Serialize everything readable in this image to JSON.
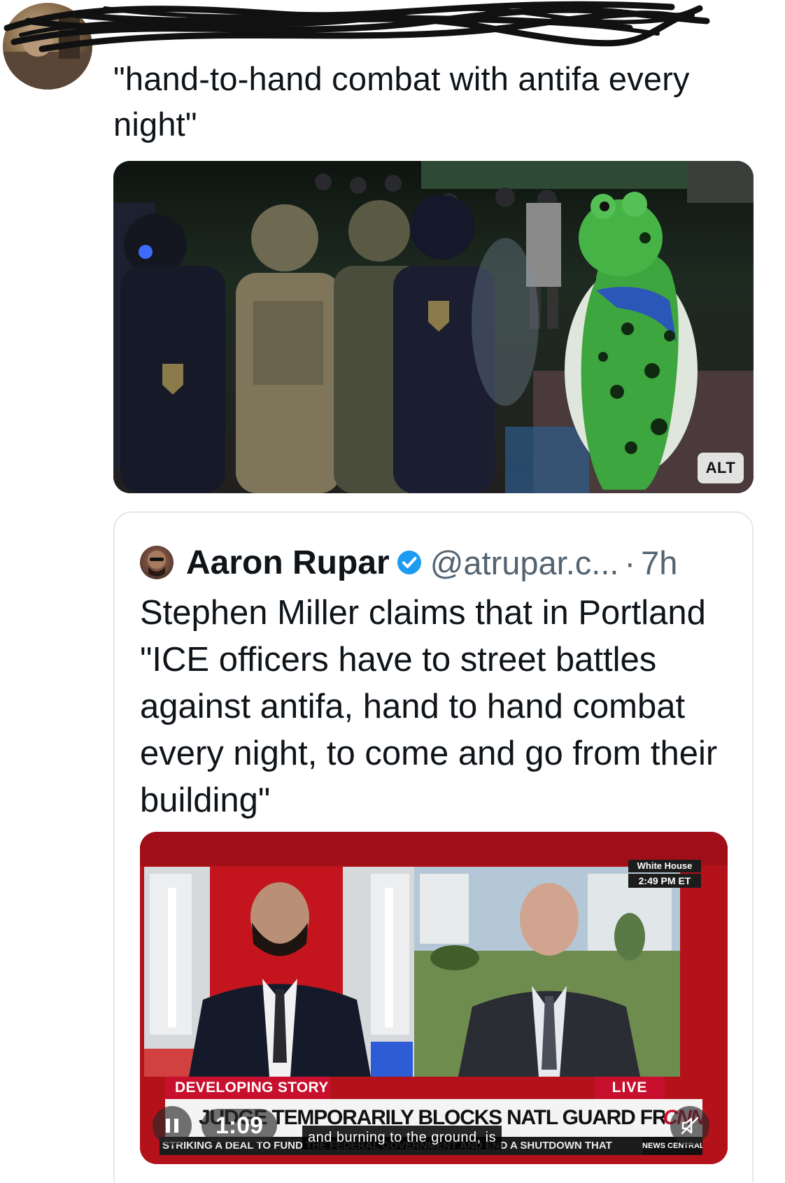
{
  "post": {
    "text": "\"hand-to-hand combat with antifa every night\""
  },
  "photo": {
    "alt_badge": "ALT"
  },
  "quoted_post": {
    "author_name": "Aaron Rupar",
    "handle": "@atrupar.c...",
    "separator": "·",
    "time": "7h",
    "text": "Stephen Miller claims that in Portland \"ICE officers have to street battles against antifa, hand to hand combat every night, to come and go from their building\""
  },
  "video": {
    "location_label": "White House",
    "location_time": "2:49 PM ET",
    "segment_label": "DEVELOPING STORY",
    "live_label": "LIVE",
    "headline": "JUDGE TEMPORARILY BLOCKS NATL GUARD FROM PORTLAND",
    "network_logo": "CNN",
    "ticker": "STRIKING A DEAL TO FUND THE FEDERAL GOVERNMENT AND END A SHUTDOWN THAT",
    "ticker_brand": "NEWS CENTRAL",
    "caption": "and burning to the ground, is",
    "elapsed": "1:09"
  },
  "icons": {
    "verified": "verified-badge-icon",
    "pause": "pause-icon",
    "mute": "muted-speaker-icon"
  },
  "colors": {
    "handle_gray": "#536471",
    "verified_blue": "#1d9bf0",
    "cnn_red": "#c8102e",
    "border": "#e4e7eb"
  }
}
